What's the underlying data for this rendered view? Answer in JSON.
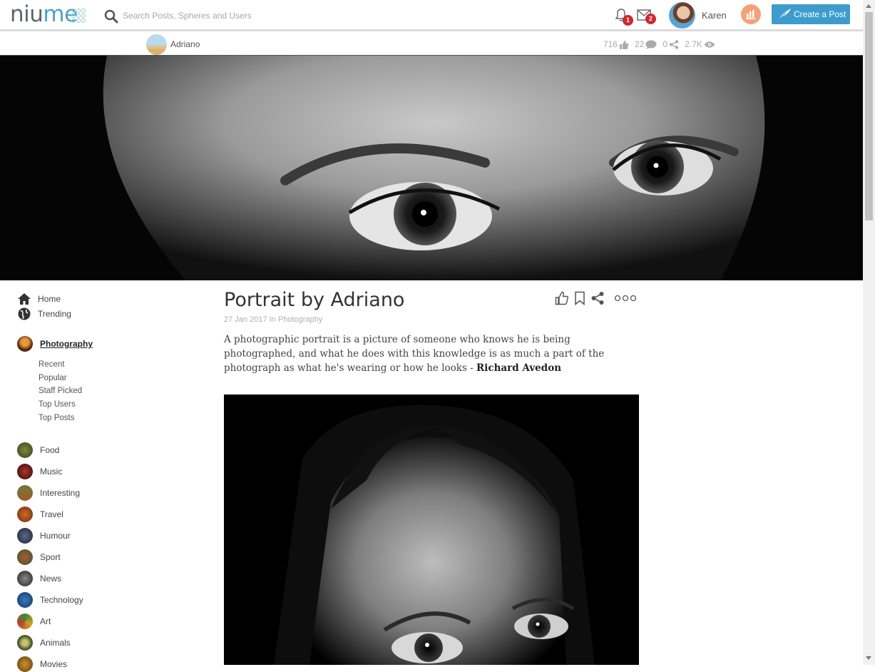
{
  "brand": {
    "logo_main": "niu",
    "logo_accent": "me"
  },
  "search": {
    "placeholder": "Search Posts, Spheres and Users"
  },
  "header": {
    "notifications_count": "1",
    "messages_count": "2",
    "user_name": "Karen",
    "create_post_label": "Create a Post"
  },
  "author_bar": {
    "author_name": "Adriano",
    "likes": "716",
    "comments": "22",
    "shares": "0",
    "views": "2.7K"
  },
  "sidebar": {
    "home": "Home",
    "trending": "Trending",
    "active_category": "Photography",
    "sub_links": [
      "Recent",
      "Popular",
      "Staff Picked",
      "Top Users",
      "Top Posts"
    ],
    "categories": [
      "Food",
      "Music",
      "Interesting",
      "Travel",
      "Humour",
      "Sport",
      "News",
      "Technology",
      "Art",
      "Animals",
      "Movies"
    ]
  },
  "post": {
    "title": "Portrait by Adriano",
    "date": "27 Jan 2017",
    "in_label": "In",
    "category": "Photography",
    "quote_text": "A photographic portrait is a picture of someone who knows he is being photographed, and what he does with this knowledge is as much a part of the photograph as what he's wearing or how he looks - ",
    "quote_author": "Richard Avedon"
  },
  "colors": {
    "accent": "#3d9ccd",
    "badge": "#d0262f",
    "stats_button": "#f4a17a",
    "logo": "#5a6672"
  }
}
